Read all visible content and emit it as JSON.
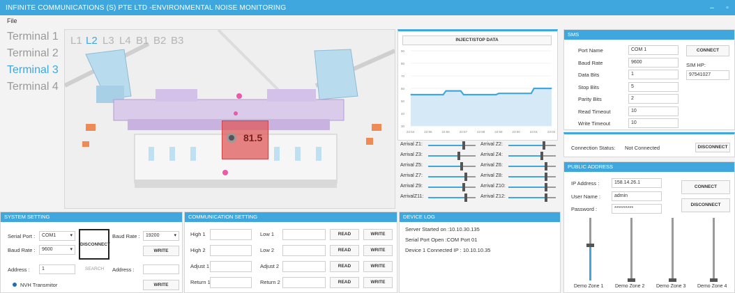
{
  "window": {
    "title": "INFINITE COMMUNICATIONS (S) PTE LTD -ENVIRONMENTAL NOISE MONITORING",
    "min_glyph": "–",
    "max_glyph": "▫"
  },
  "menu": {
    "file": "File"
  },
  "terminals": [
    "Terminal 1",
    "Terminal 2",
    "Terminal 3",
    "Terminal 4"
  ],
  "active_terminal": "Terminal 3",
  "levels": [
    "L1",
    "L2",
    "L3",
    "L4",
    "B1",
    "B2",
    "B3"
  ],
  "active_level": "L2",
  "map": {
    "noise_value": "81.5"
  },
  "chart": {
    "button": "INJECT/STOP DATA",
    "y_ticks": [
      "90",
      "80",
      "70",
      "60",
      "50",
      "40",
      "30"
    ],
    "x_ticks": [
      "22:54",
      "22:55",
      "22:56",
      "22:57",
      "22:58",
      "22:59",
      "23:00",
      "23:01",
      "23:02"
    ]
  },
  "chart_data": {
    "type": "area",
    "x": [
      "22:54",
      "22:55",
      "22:56",
      "22:57",
      "22:58",
      "22:59",
      "23:00",
      "23:01",
      "23:02"
    ],
    "y": [
      55,
      55,
      58,
      55,
      55,
      56,
      56,
      60,
      60
    ],
    "ylim": [
      30,
      90
    ],
    "title": "",
    "xlabel": "",
    "ylabel": ""
  },
  "arrivals": [
    {
      "label": "Arrival Z1:",
      "value": 0.75
    },
    {
      "label": "Arrival Z2:",
      "value": 0.75
    },
    {
      "label": "Arrival Z3:",
      "value": 0.65
    },
    {
      "label": "Arrival Z4:",
      "value": 0.7
    },
    {
      "label": "Arrival Z5:",
      "value": 0.7
    },
    {
      "label": "Arrival Z6:",
      "value": 0.8
    },
    {
      "label": "Arrival Z7:",
      "value": 0.8
    },
    {
      "label": "Arrival Z8:",
      "value": 0.8
    },
    {
      "label": "Arrival Z9:",
      "value": 0.75
    },
    {
      "label": "Arrival Z10:",
      "value": 0.8
    },
    {
      "label": "ArrivalZ11:",
      "value": 0.8
    },
    {
      "label": "Arrival Z12:",
      "value": 0.8
    }
  ],
  "sms": {
    "header": "SMS",
    "fields": [
      {
        "label": "Port Name",
        "value": "COM 1"
      },
      {
        "label": "Baud Rate",
        "value": "9600"
      },
      {
        "label": "Data Bits",
        "value": "1"
      },
      {
        "label": "Stop Bits",
        "value": "5"
      },
      {
        "label": "Parity Bits",
        "value": "2"
      },
      {
        "label": "Read Timeout",
        "value": "10"
      },
      {
        "label": "Write Timeout",
        "value": "10"
      }
    ],
    "connect": "CONNECT",
    "sim_label": "SIM HP:",
    "sim_value": "97541027",
    "status_label": "Connection Status:",
    "status_value": "Not Connected",
    "disconnect": "DISCONNECT"
  },
  "public_address": {
    "header": "PUBLIC ADDRESS",
    "ip_label": "IP Address :",
    "ip_value": "158.14.26.1",
    "user_label": "User Name :",
    "user_value": "admin",
    "pass_label": "Password :",
    "pass_value": "**********",
    "connect": "CONNECT",
    "disconnect": "DISCONNECT",
    "zones": [
      {
        "label": "Demo Zone 1",
        "value": 0.55
      },
      {
        "label": "Demo Zone 2",
        "value": 0.0
      },
      {
        "label": "Demo Zone 3",
        "value": 0.0
      },
      {
        "label": "Demo Zone 4",
        "value": 0.0
      }
    ]
  },
  "system": {
    "header": "SYSTEM SETTING",
    "serial_port_label": "Serial Port :",
    "serial_port_value": "COM1",
    "baud_label": "Baud Rate :",
    "baud_value": "9600",
    "disconnect": "DISCONNECT",
    "baud2_label": "Baud Rate :",
    "baud2_value": "19200",
    "write": "WRITE",
    "address_label": "Address :",
    "address_value": "1",
    "search": "SEARCH",
    "address2_label": "Address :",
    "transmitter": "NVH Transmitor",
    "write2": "WRITE"
  },
  "communication": {
    "header": "COMMUNICATION SETTING",
    "rows": [
      {
        "left": "High 1",
        "right": "Low 1",
        "b1": "READ",
        "b2": "WRITE"
      },
      {
        "left": "High 2",
        "right": "Low 2",
        "b1": "READ",
        "b2": "WRITE"
      },
      {
        "left": "Adjust 1",
        "right": "Adjust 2",
        "b1": "READ",
        "b2": "WRITE"
      },
      {
        "left": "Return 1",
        "right": "Return 2",
        "b1": "READ",
        "b2": "WRITE"
      }
    ]
  },
  "device_log": {
    "header": "DEVICE LOG",
    "lines": [
      "Server Started on :10.10.30.135",
      "Serial Port Open :COM Port 01",
      "Device 1 Connected IP : 10.10.10.35"
    ]
  },
  "colors": {
    "accent": "#3fa7dd",
    "alert": "#e05a5a"
  }
}
